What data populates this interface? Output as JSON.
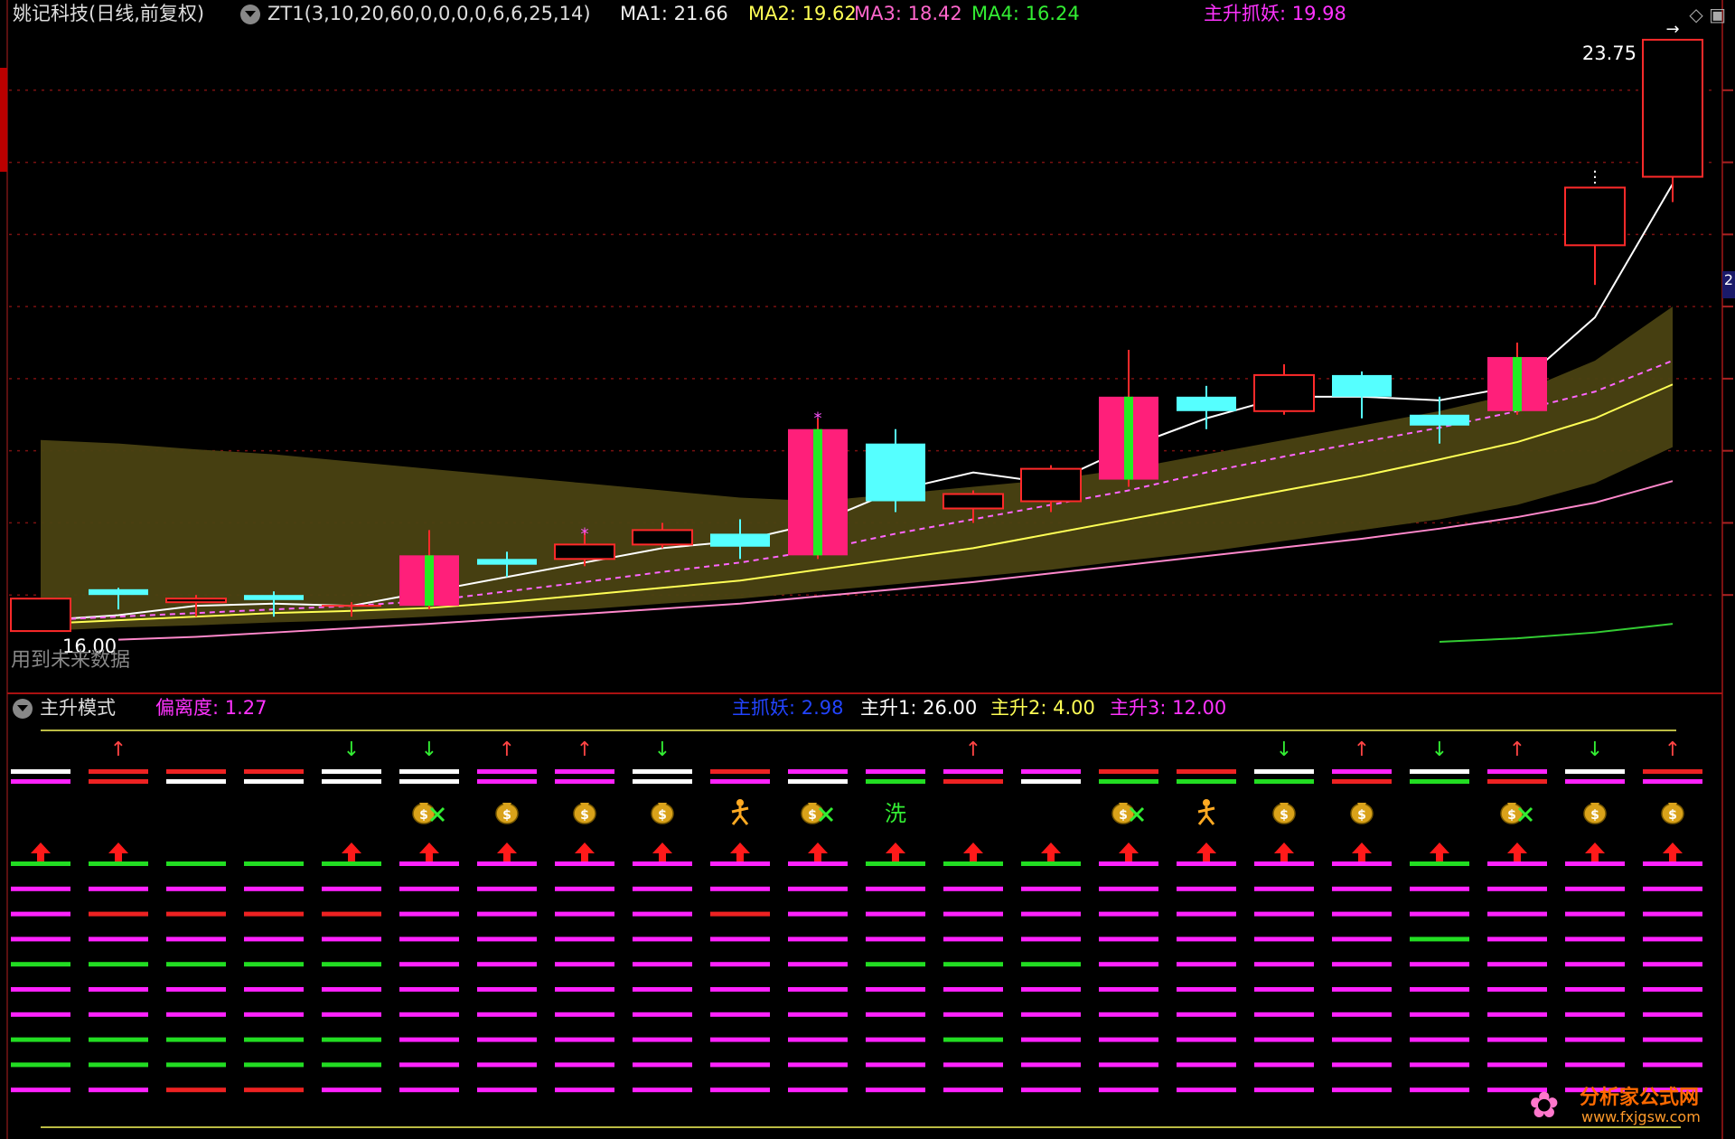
{
  "header": {
    "title": "姚记科技(日线,前复权)",
    "indicator": "ZT1(3,10,20,60,0,0,0,0,6,6,25,14)",
    "ma1_label": "MA1: 21.66",
    "ma2_label": "MA2: 19.62",
    "ma3_label": "MA3: 18.42",
    "ma4_label": "MA4: 16.24",
    "main_signal_label": "主升抓妖: 19.98"
  },
  "sub_header": {
    "panel_name": "主升模式",
    "deviation_label": "偏离度: 1.27",
    "zhuzhuayao_label": "主抓妖: 2.98",
    "zs1_label": "主升1: 26.00",
    "zs2_label": "主升2: 4.00",
    "zs3_label": "主升3: 12.00"
  },
  "top_right_icons": "◇ ▣",
  "side_tag": "2",
  "use_tip": "用到未来数据",
  "watermark": {
    "title": "分析家公式网",
    "url": "www.fxjgsw.com"
  },
  "colors": {
    "up": "#ff2a2a",
    "down": "#55ffff",
    "ma1": "#ffffff",
    "ma2": "#ffff55",
    "ma3": "#ff88cc",
    "ma4": "#33cc33",
    "band": "#4a4212",
    "magenta": "#ff22ff",
    "green": "#22dd22",
    "white": "#ffffff",
    "red": "#ee2222",
    "grid": "#7a1111"
  },
  "chart_data": {
    "type": "candlestick",
    "ylim": [
      15.6,
      24.4
    ],
    "price_labels": {
      "high": "23.75",
      "low": "16.00"
    },
    "grid_levels": [
      16.5,
      17.5,
      18.5,
      19.5,
      20.5,
      21.5,
      22.5,
      23.5
    ],
    "candles": [
      {
        "o": 16.45,
        "c": 16.0,
        "h": 16.45,
        "l": 16.0,
        "style": "hollow-red"
      },
      {
        "o": 16.5,
        "c": 16.58,
        "h": 16.6,
        "l": 16.3,
        "style": "cyan"
      },
      {
        "o": 16.45,
        "c": 16.4,
        "h": 16.5,
        "l": 16.2,
        "style": "hollow-red"
      },
      {
        "o": 16.5,
        "c": 16.43,
        "h": 16.55,
        "l": 16.2,
        "style": "cyan"
      },
      {
        "o": 16.35,
        "c": 16.35,
        "h": 16.4,
        "l": 16.2,
        "style": "doji"
      },
      {
        "o": 16.35,
        "c": 17.05,
        "h": 17.4,
        "l": 16.3,
        "style": "strong"
      },
      {
        "o": 17.0,
        "c": 16.92,
        "h": 17.1,
        "l": 16.75,
        "style": "cyan",
        "mark": ""
      },
      {
        "o": 17.0,
        "c": 17.2,
        "h": 17.4,
        "l": 16.9,
        "style": "hollow-red",
        "mark": "*"
      },
      {
        "o": 17.2,
        "c": 17.4,
        "h": 17.5,
        "l": 17.15,
        "style": "hollow-red"
      },
      {
        "o": 17.35,
        "c": 17.17,
        "h": 17.55,
        "l": 17.0,
        "style": "cyan"
      },
      {
        "o": 17.05,
        "c": 18.8,
        "h": 18.95,
        "l": 17.0,
        "style": "strong",
        "mark": "*"
      },
      {
        "o": 18.6,
        "c": 17.8,
        "h": 18.8,
        "l": 17.65,
        "style": "cyan"
      },
      {
        "o": 17.7,
        "c": 17.9,
        "h": 17.95,
        "l": 17.5,
        "style": "hollow-red"
      },
      {
        "o": 17.8,
        "c": 18.25,
        "h": 18.3,
        "l": 17.65,
        "style": "hollow-red"
      },
      {
        "o": 18.1,
        "c": 19.25,
        "h": 19.9,
        "l": 18.0,
        "style": "strong"
      },
      {
        "o": 19.25,
        "c": 19.05,
        "h": 19.4,
        "l": 18.8,
        "style": "cyan"
      },
      {
        "o": 19.05,
        "c": 19.55,
        "h": 19.7,
        "l": 19.0,
        "style": "hollow-red"
      },
      {
        "o": 19.55,
        "c": 19.25,
        "h": 19.6,
        "l": 18.95,
        "style": "cyan"
      },
      {
        "o": 19.0,
        "c": 18.85,
        "h": 19.25,
        "l": 18.6,
        "style": "cyan"
      },
      {
        "o": 19.05,
        "c": 19.8,
        "h": 20.0,
        "l": 19.0,
        "style": "strong"
      },
      {
        "o": 21.35,
        "c": 22.15,
        "h": 22.15,
        "l": 20.8,
        "style": "hollow-red",
        "mark": "⋮"
      },
      {
        "o": 22.3,
        "c": 24.2,
        "h": 24.2,
        "l": 21.95,
        "style": "hollow-red",
        "mark": "→"
      }
    ],
    "series": [
      {
        "name": "MA1",
        "color": "#ffffff",
        "values": [
          16.15,
          16.22,
          16.35,
          16.38,
          16.35,
          16.55,
          16.75,
          16.95,
          17.15,
          17.25,
          17.5,
          17.95,
          18.2,
          18.05,
          18.55,
          18.95,
          19.25,
          19.25,
          19.2,
          19.4,
          20.35,
          22.2
        ]
      },
      {
        "name": "MA2",
        "color": "#ff66ff",
        "dashed": true,
        "values": [
          16.15,
          16.2,
          16.25,
          16.3,
          16.35,
          16.42,
          16.55,
          16.68,
          16.82,
          16.95,
          17.12,
          17.35,
          17.55,
          17.75,
          17.95,
          18.2,
          18.42,
          18.62,
          18.82,
          19.05,
          19.32,
          19.75
        ]
      },
      {
        "name": "MA3",
        "color": "#ffff55",
        "values": [
          16.1,
          16.15,
          16.2,
          16.25,
          16.28,
          16.32,
          16.4,
          16.5,
          16.6,
          16.7,
          16.85,
          17.0,
          17.15,
          17.35,
          17.55,
          17.75,
          17.95,
          18.15,
          18.38,
          18.62,
          18.95,
          19.42
        ]
      },
      {
        "name": "MA4",
        "color": "#ff88cc",
        "values": [
          null,
          15.88,
          15.92,
          15.98,
          16.04,
          16.1,
          16.17,
          16.24,
          16.31,
          16.38,
          16.48,
          16.58,
          16.68,
          16.8,
          16.92,
          17.04,
          17.16,
          17.28,
          17.42,
          17.58,
          17.78,
          18.08
        ]
      },
      {
        "name": "MA5",
        "color": "#33cc33",
        "values": [
          null,
          null,
          null,
          null,
          null,
          null,
          null,
          null,
          null,
          null,
          null,
          null,
          null,
          null,
          null,
          null,
          null,
          null,
          15.85,
          15.9,
          15.98,
          16.1
        ]
      }
    ],
    "band": {
      "upper": [
        18.65,
        18.6,
        18.52,
        18.45,
        18.35,
        18.25,
        18.15,
        18.05,
        17.95,
        17.85,
        17.8,
        17.9,
        18.0,
        18.1,
        18.25,
        18.45,
        18.65,
        18.85,
        19.05,
        19.3,
        19.75,
        20.5
      ],
      "lower": [
        16.0,
        16.05,
        16.08,
        16.12,
        16.15,
        16.2,
        16.25,
        16.3,
        16.38,
        16.45,
        16.55,
        16.65,
        16.75,
        16.85,
        16.98,
        17.1,
        17.25,
        17.4,
        17.55,
        17.75,
        18.05,
        18.55
      ]
    },
    "signals": {
      "arrows_top": [
        "",
        "up",
        "",
        "",
        "down",
        "down",
        "up",
        "up",
        "down",
        "",
        "",
        "",
        "up",
        "",
        "",
        "",
        "down",
        "up",
        "down",
        "up",
        "down",
        "up"
      ],
      "row1": [
        [
          "white",
          "magenta"
        ],
        [
          "red",
          "red"
        ],
        [
          "red",
          "white"
        ],
        [
          "red",
          "white"
        ],
        [
          "white",
          "white"
        ],
        [
          "white",
          "white"
        ],
        [
          "magenta",
          "magenta"
        ],
        [
          "magenta",
          "magenta"
        ],
        [
          "white",
          "white"
        ],
        [
          "red",
          "magenta"
        ],
        [
          "magenta",
          "white"
        ],
        [
          "magenta",
          "green"
        ],
        [
          "magenta",
          "red"
        ],
        [
          "magenta",
          "white"
        ],
        [
          "red",
          "green"
        ],
        [
          "red",
          "green"
        ],
        [
          "white",
          "green"
        ],
        [
          "magenta",
          "red"
        ],
        [
          "white",
          "green"
        ],
        [
          "magenta",
          "red"
        ],
        [
          "white",
          "magenta"
        ],
        [
          "red",
          "magenta"
        ]
      ],
      "icons": [
        "",
        "",
        "",
        "",
        "",
        "bag-sell",
        "bag",
        "bag",
        "bag",
        "run",
        "bag-sell",
        "wash",
        "",
        "",
        "bag-sell",
        "run",
        "bag",
        "bag",
        "",
        "bag-sell",
        "bag",
        "bag"
      ],
      "wash_text": "洗",
      "grid_rows": [
        [
          "green",
          "green",
          "green",
          "green",
          "green",
          "magenta",
          "magenta",
          "magenta",
          "magenta",
          "magenta",
          "magenta",
          "green",
          "green",
          "green",
          "magenta",
          "magenta",
          "magenta",
          "magenta",
          "green",
          "magenta",
          "magenta",
          "magenta"
        ],
        [
          "magenta",
          "magenta",
          "magenta",
          "magenta",
          "magenta",
          "magenta",
          "magenta",
          "magenta",
          "magenta",
          "magenta",
          "magenta",
          "magenta",
          "magenta",
          "magenta",
          "magenta",
          "magenta",
          "magenta",
          "magenta",
          "magenta",
          "magenta",
          "magenta",
          "magenta"
        ],
        [
          "magenta",
          "red",
          "red",
          "red",
          "red",
          "magenta",
          "magenta",
          "magenta",
          "magenta",
          "red",
          "magenta",
          "magenta",
          "magenta",
          "magenta",
          "magenta",
          "magenta",
          "magenta",
          "magenta",
          "magenta",
          "magenta",
          "magenta",
          "magenta"
        ],
        [
          "magenta",
          "magenta",
          "magenta",
          "magenta",
          "magenta",
          "magenta",
          "magenta",
          "magenta",
          "magenta",
          "magenta",
          "magenta",
          "magenta",
          "magenta",
          "magenta",
          "magenta",
          "magenta",
          "magenta",
          "magenta",
          "green",
          "magenta",
          "magenta",
          "magenta"
        ],
        [
          "green",
          "green",
          "green",
          "green",
          "green",
          "magenta",
          "magenta",
          "magenta",
          "magenta",
          "magenta",
          "magenta",
          "green",
          "green",
          "green",
          "magenta",
          "magenta",
          "magenta",
          "magenta",
          "magenta",
          "magenta",
          "magenta",
          "magenta"
        ],
        [
          "magenta",
          "magenta",
          "magenta",
          "magenta",
          "magenta",
          "magenta",
          "magenta",
          "magenta",
          "magenta",
          "magenta",
          "magenta",
          "magenta",
          "magenta",
          "magenta",
          "magenta",
          "magenta",
          "magenta",
          "magenta",
          "magenta",
          "magenta",
          "magenta",
          "magenta"
        ],
        [
          "magenta",
          "magenta",
          "magenta",
          "magenta",
          "magenta",
          "magenta",
          "magenta",
          "magenta",
          "magenta",
          "magenta",
          "magenta",
          "magenta",
          "magenta",
          "magenta",
          "magenta",
          "magenta",
          "magenta",
          "magenta",
          "magenta",
          "magenta",
          "magenta",
          "magenta"
        ],
        [
          "green",
          "green",
          "green",
          "green",
          "green",
          "magenta",
          "magenta",
          "magenta",
          "magenta",
          "magenta",
          "magenta",
          "magenta",
          "green",
          "magenta",
          "magenta",
          "magenta",
          "magenta",
          "magenta",
          "magenta",
          "magenta",
          "magenta",
          "magenta"
        ],
        [
          "green",
          "green",
          "green",
          "green",
          "green",
          "magenta",
          "magenta",
          "magenta",
          "magenta",
          "magenta",
          "magenta",
          "magenta",
          "magenta",
          "magenta",
          "magenta",
          "magenta",
          "magenta",
          "magenta",
          "magenta",
          "magenta",
          "magenta",
          "magenta"
        ],
        [
          "magenta",
          "magenta",
          "red",
          "red",
          "magenta",
          "magenta",
          "magenta",
          "magenta",
          "magenta",
          "magenta",
          "magenta",
          "magenta",
          "magenta",
          "magenta",
          "magenta",
          "magenta",
          "magenta",
          "magenta",
          "magenta",
          "magenta",
          "magenta",
          "magenta"
        ]
      ]
    }
  }
}
